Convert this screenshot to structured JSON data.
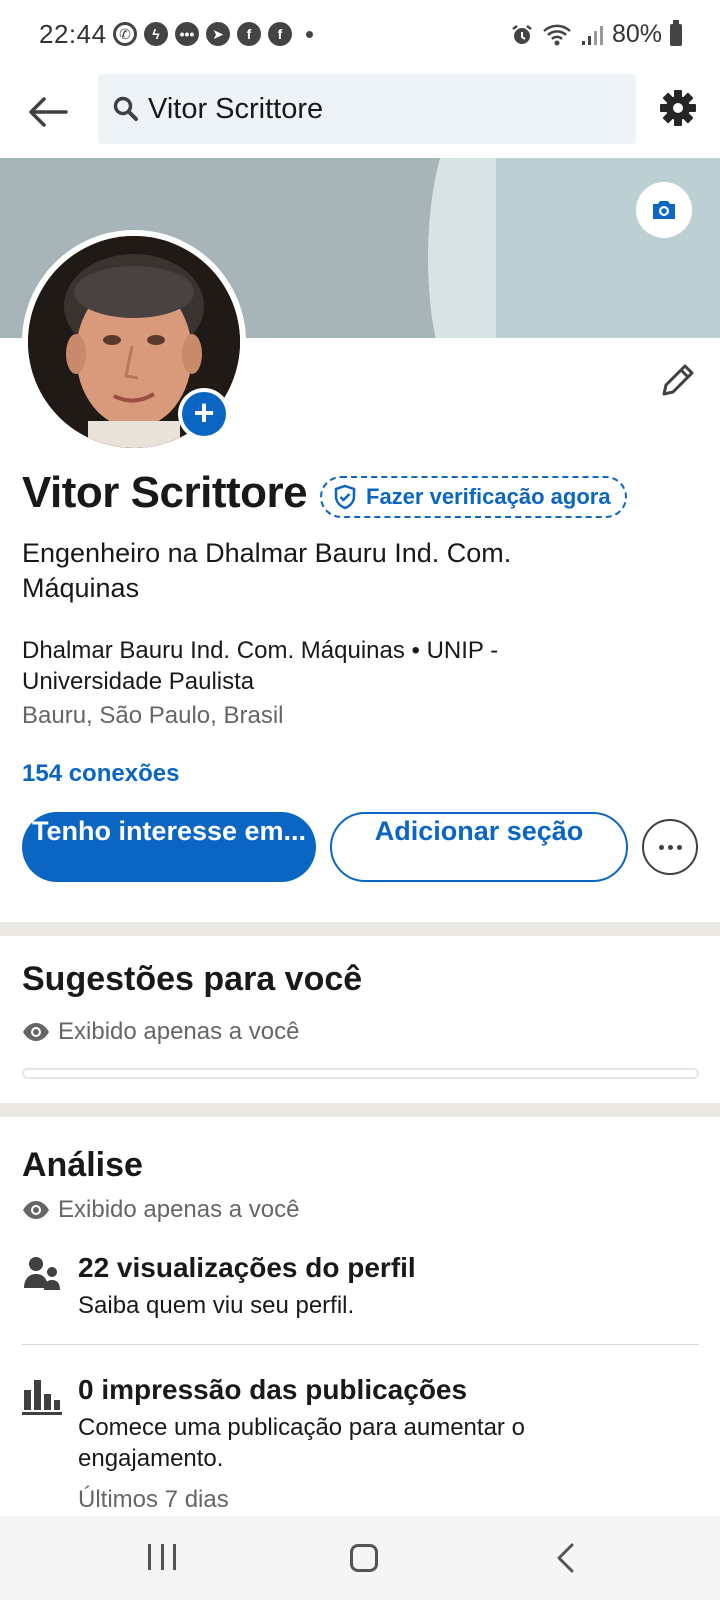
{
  "status_bar": {
    "time": "22:44",
    "notification_icons": [
      "whatsapp-icon",
      "messenger-icon",
      "messages-icon",
      "telegram-icon",
      "facebook-icon",
      "facebook-icon"
    ],
    "battery": "80%"
  },
  "header": {
    "search_value": "Vitor Scrittore"
  },
  "profile": {
    "name": "Vitor Scrittore",
    "verify_label": "Fazer verificação agora",
    "headline": "Engenheiro na Dhalmar Bauru Ind. Com. Máquinas",
    "company_line": "Dhalmar Bauru Ind. Com. Máquinas • UNIP - Universidade Paulista",
    "location": "Bauru, São Paulo, Brasil",
    "connections": "154 conexões",
    "primary_button": "Tenho interesse em...",
    "secondary_button": "Adicionar seção"
  },
  "suggestions": {
    "title": "Sugestões para você",
    "visibility": "Exibido apenas a você"
  },
  "analysis": {
    "title": "Análise",
    "visibility": "Exibido apenas a você",
    "items": [
      {
        "icon": "people-icon",
        "title": "22 visualizações do perfil",
        "subtitle": "Saiba quem viu seu perfil."
      },
      {
        "icon": "bar-chart-icon",
        "title": "0 impressão das publicações",
        "subtitle": "Comece uma publicação para aumentar o engajamento.",
        "period": "Últimos 7 dias"
      }
    ]
  },
  "colors": {
    "brand_blue": "#0a66c2",
    "section_band": "#ebe9e4",
    "cover": "#a7b5b8"
  }
}
